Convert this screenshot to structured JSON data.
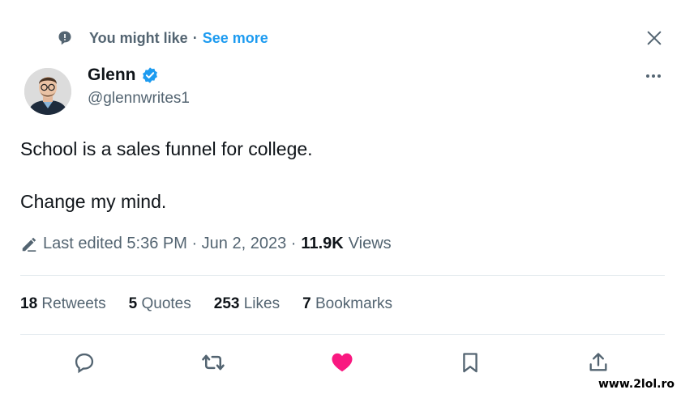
{
  "context": {
    "text": "You might like",
    "separator": "·",
    "link": "See more"
  },
  "icons": {
    "context": "suggestion-bubble-icon",
    "close": "close-icon",
    "more": "more-options-icon",
    "verified": "verified-badge-icon",
    "edit": "pencil-edit-icon"
  },
  "author": {
    "name": "Glenn",
    "handle": "@glennwrites1",
    "verified": true
  },
  "tweet": {
    "line1": "School is a sales funnel for college.",
    "line2": "Change my mind."
  },
  "meta": {
    "edited": "Last edited 5:36 PM · Jun 2, 2023 ·",
    "views_count": "11.9K",
    "views_label": "Views"
  },
  "stats": [
    {
      "count": "18",
      "label": "Retweets"
    },
    {
      "count": "5",
      "label": "Quotes"
    },
    {
      "count": "253",
      "label": "Likes"
    },
    {
      "count": "7",
      "label": "Bookmarks"
    }
  ],
  "actions": [
    "reply-icon",
    "retweet-icon",
    "like-icon",
    "bookmark-icon",
    "share-icon"
  ],
  "colors": {
    "accent": "#1d9bf0",
    "like": "#f91880",
    "muted": "#536471",
    "text": "#0f1419"
  },
  "watermark": "www.2lol.ro"
}
